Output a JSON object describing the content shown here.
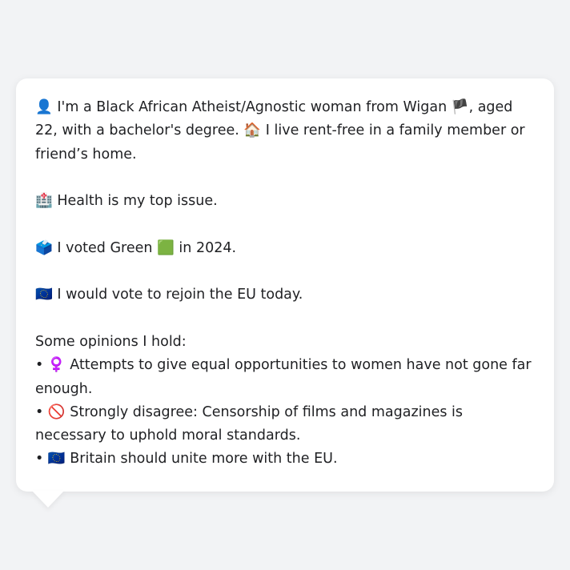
{
  "profile": {
    "intro": {
      "icon": "👤",
      "text_a": "I'm a Black African Atheist/Agnostic woman from Wigan",
      "flag": "🏴",
      "text_b": ", aged 22, with a bachelor's degree.",
      "home_icon": "🏠",
      "text_c": "I live rent-free in a family member or friend’s home."
    },
    "issue": {
      "icon": "🏥",
      "text": "Health is my top issue."
    },
    "vote": {
      "icon": "🗳️",
      "text_a": "I voted Green",
      "party_icon": "🟩",
      "text_b": "in 2024."
    },
    "eu": {
      "icon": "🇪🇺",
      "text": "I would vote to rejoin the EU today."
    },
    "opinions_heading": "Some opinions I hold:",
    "opinions": [
      {
        "bullet": "•",
        "icon": "♀️",
        "text": "Attempts to give equal opportunities to women have not gone far enough."
      },
      {
        "bullet": "•",
        "icon": "🚫",
        "text": "Strongly disagree: Censorship of films and magazines is necessary to uphold moral standards."
      },
      {
        "bullet": "•",
        "icon": "🇪🇺",
        "text": "Britain should unite more with the EU."
      }
    ]
  }
}
